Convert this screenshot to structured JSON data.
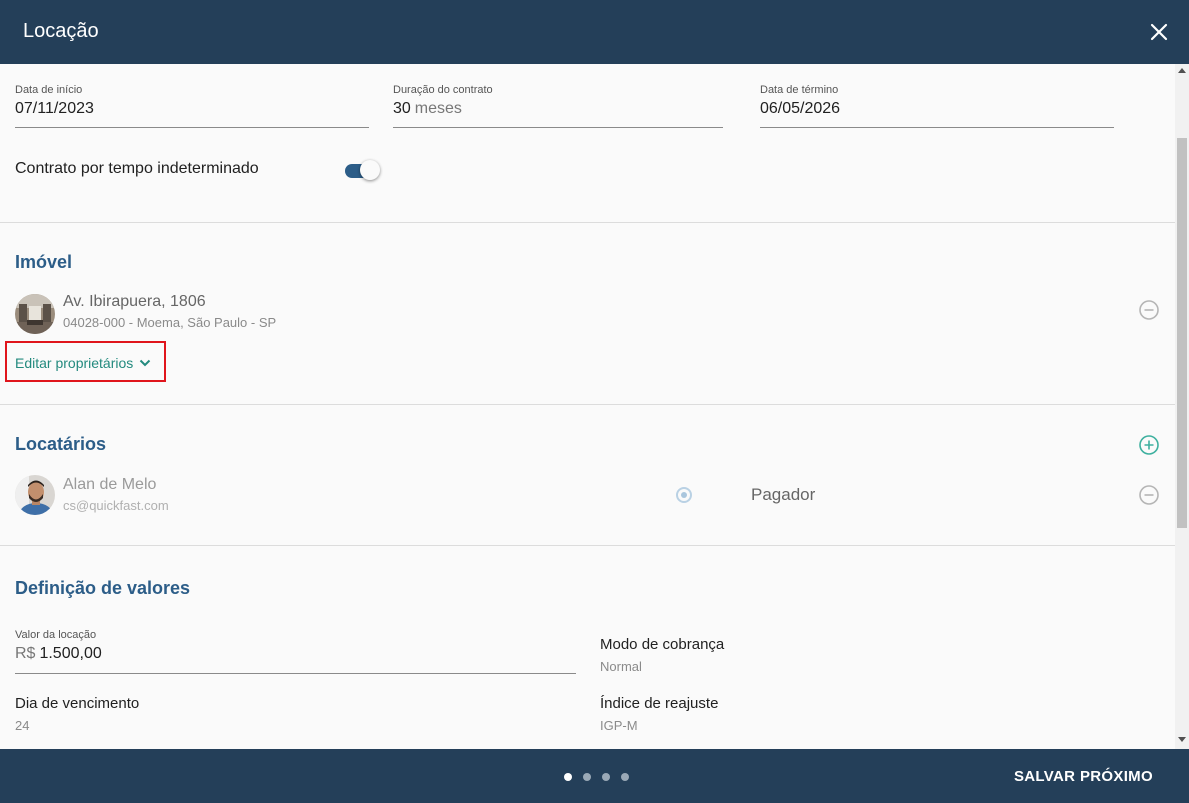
{
  "dialog": {
    "title": "Locação",
    "close_icon": "close-icon"
  },
  "contract": {
    "start_date": {
      "label": "Data de início",
      "value": "07/11/2023"
    },
    "duration": {
      "label": "Duração do contrato",
      "value": "30",
      "suffix": "meses"
    },
    "end_date": {
      "label": "Data de término",
      "value": "06/05/2026"
    },
    "indefinite": {
      "label": "Contrato por tempo indeterminado",
      "on": true
    }
  },
  "property": {
    "section_title": "Imóvel",
    "address": "Av. Ibirapuera, 1806",
    "details": "04028-000 - Moema, São Paulo - SP",
    "edit_owners_label": "Editar proprietários",
    "remove_icon": "minus-circle-icon"
  },
  "tenants": {
    "section_title": "Locatários",
    "add_icon": "plus-circle-icon",
    "items": [
      {
        "name": "Alan de Melo",
        "email": "cs@quickfast.com",
        "role": "Pagador",
        "payer_selected": true
      }
    ]
  },
  "values": {
    "section_title": "Definição de valores",
    "rent": {
      "label": "Valor da locação",
      "prefix": "R$",
      "value": "1.500,00"
    },
    "billing_mode": {
      "label": "Modo de cobrança",
      "value": "Normal"
    },
    "due_day": {
      "label": "Dia de vencimento",
      "value": "24"
    },
    "adjustment_index": {
      "label": "Índice de reajuste",
      "value": "IGP-M"
    }
  },
  "footer": {
    "steps_total": 4,
    "active_step": 1,
    "save_label": "SALVAR",
    "next_label": "PRÓXIMO"
  },
  "colors": {
    "header_bg": "#243f59",
    "accent_blue": "#2c5d88",
    "accent_green": "#238a7e",
    "highlight_red": "#e0151c"
  }
}
